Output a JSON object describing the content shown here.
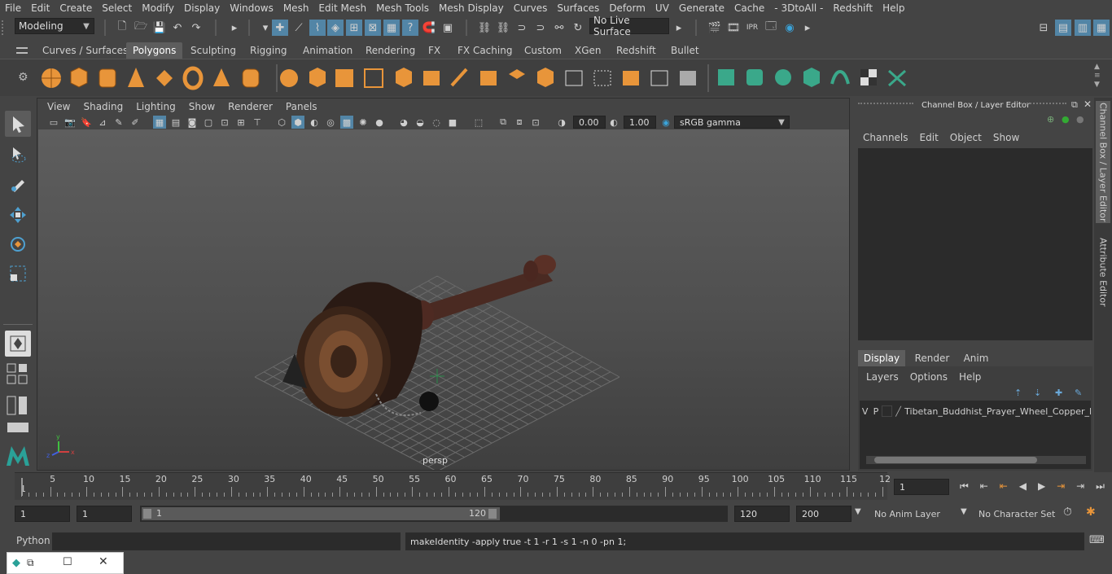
{
  "menubar": [
    "File",
    "Edit",
    "Create",
    "Select",
    "Modify",
    "Display",
    "Windows",
    "Mesh",
    "Edit Mesh",
    "Mesh Tools",
    "Mesh Display",
    "Curves",
    "Surfaces",
    "Deform",
    "UV",
    "Generate",
    "Cache",
    "- 3DtoAll -",
    "Redshift",
    "Help"
  ],
  "statusline": {
    "workspace": "Modeling",
    "live_surface": "No Live Surface"
  },
  "shelf_tabs": [
    "Curves / Surfaces",
    "Polygons",
    "Sculpting",
    "Rigging",
    "Animation",
    "Rendering",
    "FX",
    "FX Caching",
    "Custom",
    "XGen",
    "Redshift",
    "Bullet"
  ],
  "panel_menu": [
    "View",
    "Shading",
    "Lighting",
    "Show",
    "Renderer",
    "Panels"
  ],
  "panel_bar": {
    "exposure": "0.00",
    "gamma": "1.00",
    "colorspace": "sRGB gamma"
  },
  "viewport": {
    "camera_label": "persp"
  },
  "channelbox": {
    "title": "Channel Box / Layer Editor",
    "menus": [
      "Channels",
      "Edit",
      "Object",
      "Show"
    ],
    "tabs": [
      "Display",
      "Render",
      "Anim"
    ],
    "layer_menus": [
      "Layers",
      "Options",
      "Help"
    ],
    "layer": {
      "v": "V",
      "p": "P",
      "name": "Tibetan_Buddhist_Prayer_Wheel_Copper_Ba"
    }
  },
  "side_tabs": [
    "Channel Box / Layer Editor",
    "Attribute Editor"
  ],
  "timeline": {
    "ticks": [
      "5",
      "10",
      "15",
      "20",
      "25",
      "30",
      "35",
      "40",
      "45",
      "50",
      "55",
      "60",
      "65",
      "70",
      "75",
      "80",
      "85",
      "90",
      "95",
      "100",
      "105",
      "110",
      "115",
      "12"
    ],
    "start_label": "1",
    "current_frame": "1"
  },
  "range": {
    "start": "1",
    "anim_start": "1",
    "slider_start": "1",
    "slider_end": "120",
    "end": "120",
    "anim_end": "200",
    "anim_layer": "No Anim Layer",
    "character_set": "No Character Set"
  },
  "cmdline": {
    "language": "Python",
    "result": "makeIdentity -apply true -t 1 -r 1 -s 1 -n 0 -pn 1;"
  },
  "colors": {
    "accent_teal": "#2aa198",
    "accent_blue": "#4a90d9",
    "shelf_orange": "#e8953a"
  }
}
